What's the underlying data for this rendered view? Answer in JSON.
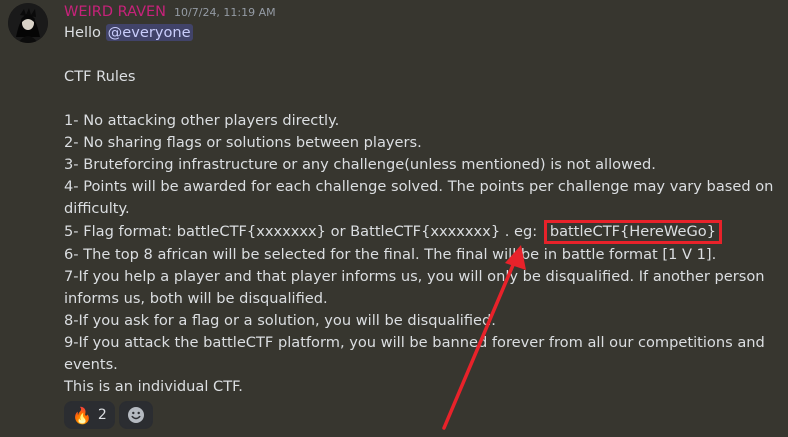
{
  "message": {
    "username": "WEIRD RAVEN",
    "timestamp": "10/7/24, 11:19 AM",
    "greeting": "Hello",
    "mention": "@everyone",
    "title": "CTF Rules",
    "rules": [
      "1- No attacking other players directly.",
      "2- No sharing flags or solutions between players.",
      "3- Bruteforcing infrastructure or any challenge(unless mentioned) is not allowed.",
      "4- Points will be awarded for each challenge solved. The points per challenge may vary based on",
      "difficulty."
    ],
    "rule5_prefix": "5- Flag format: battleCTF{xxxxxxx} or BattleCTF{xxxxxxx} . eg:",
    "rule5_example": "battleCTF{HereWeGo}",
    "rules_rest": [
      "6- The top 8 african will be selected for the final. The final will be in battle format [1 V 1].",
      "7-If you help a player and that player informs us, you will only be disqualified. If another person",
      "informs us, both will be disqualified.",
      "8-If you ask for a flag or a solution, you will be disqualified.",
      "9-If you attack the battleCTF platform, you will be banned forever from all our competitions and",
      "events.",
      "This is an individual CTF."
    ]
  },
  "reactions": [
    {
      "emoji": "🔥",
      "count": "2"
    }
  ],
  "add_reaction_icon": "smiley-add-reaction-icon",
  "colors": {
    "background": "#37362f",
    "username": "#c7227a",
    "highlight": "#e8222a",
    "mention_bg": "#3d4270"
  }
}
